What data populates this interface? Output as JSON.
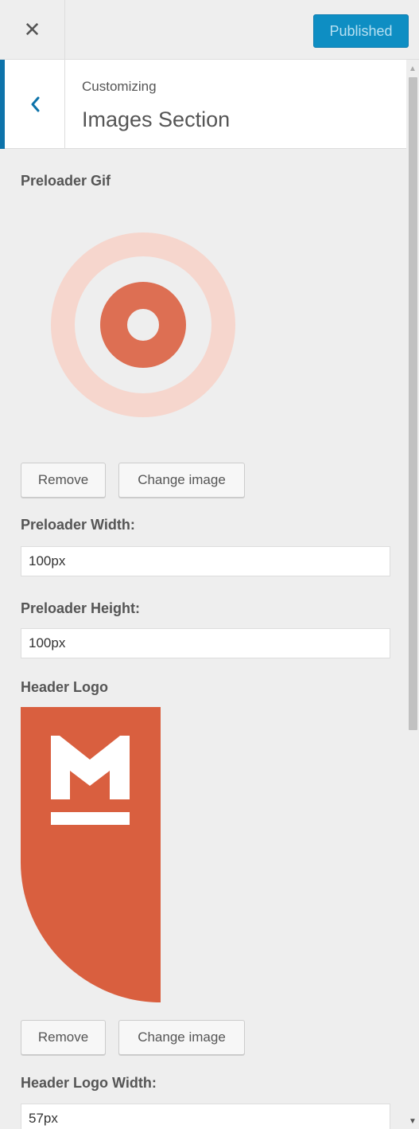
{
  "topbar": {
    "close_icon": "close-icon",
    "publish_label": "Published",
    "accent": "#0e8ec3"
  },
  "section": {
    "breadcrumb": "Customizing",
    "title": "Images Section",
    "back_icon": "chevron-left-icon"
  },
  "preloader": {
    "label": "Preloader Gif",
    "remove_label": "Remove",
    "change_label": "Change image",
    "image_icon": "target-rings-image"
  },
  "preloader_width": {
    "label": "Preloader Width:",
    "value": "100px"
  },
  "preloader_height": {
    "label": "Preloader Height:",
    "value": "100px"
  },
  "header_logo": {
    "label": "Header Logo",
    "remove_label": "Remove",
    "change_label": "Change image",
    "image_icon": "m-logo-image",
    "color": "#d95f3f"
  },
  "header_logo_width": {
    "label": "Header Logo Width:",
    "value": "57px"
  }
}
